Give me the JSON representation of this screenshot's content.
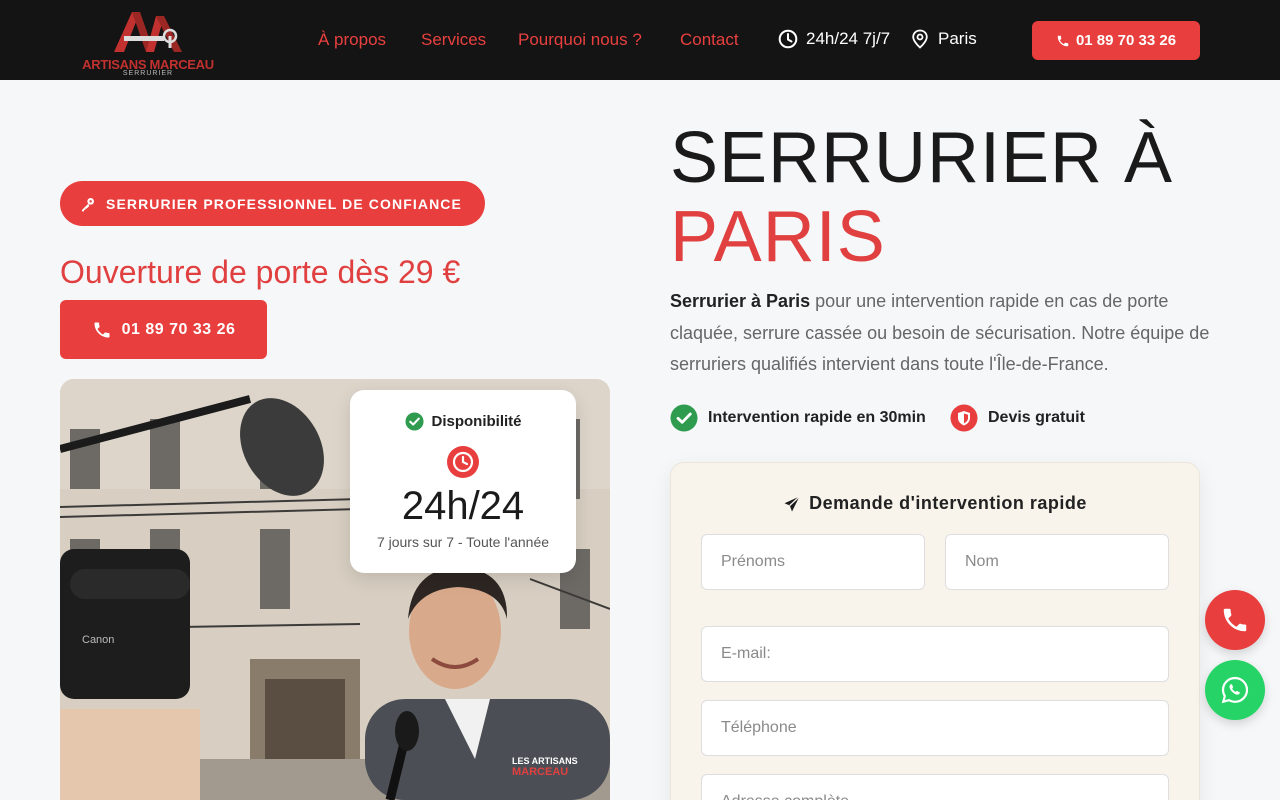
{
  "header": {
    "logo_mark": "AM",
    "logo_name": "ARTISANS MARCEAU",
    "logo_subtitle": "SERRURIER",
    "nav": [
      "À propos",
      "Services",
      "Pourquoi nous ?",
      "Contact"
    ],
    "hours": "24h/24 7j/7",
    "city": "Paris",
    "phone": "01 89 70 33 26"
  },
  "hero_left": {
    "badge": "SERRURIER PROFESSIONNEL DE CONFIANCE",
    "price_line": "Ouverture de porte dès 29 €",
    "phone": "01 89 70 33 26",
    "photo": {
      "jacket_text_1": "LES ARTISANS",
      "jacket_text_2": "MARCEAU",
      "camera_brand": "Canon"
    },
    "availability": {
      "title": "Disponibilité",
      "big": "24h/24",
      "small": "7 jours sur 7 - Toute l'année"
    }
  },
  "hero_right": {
    "title_line1": "SERRURIER À",
    "title_line2": "PARIS",
    "desc_bold": "Serrurier à Paris",
    "desc_rest": " pour une intervention rapide en cas de porte claquée, serrure cassée ou besoin de sécurisation. Notre équipe de serruriers qualifiés intervient dans toute l'Île-de-France.",
    "features": [
      "Intervention rapide en 30min",
      "Devis gratuit"
    ]
  },
  "form": {
    "title": "Demande d'intervention rapide",
    "prenoms": "Prénoms",
    "nom": "Nom",
    "email": "E-mail:",
    "telephone": "Téléphone",
    "adresse": "Adresse complète"
  },
  "colors": {
    "accent": "#e83e3d",
    "header_bg": "#141414",
    "whatsapp": "#25d366",
    "check_green": "#2e9b4f"
  }
}
